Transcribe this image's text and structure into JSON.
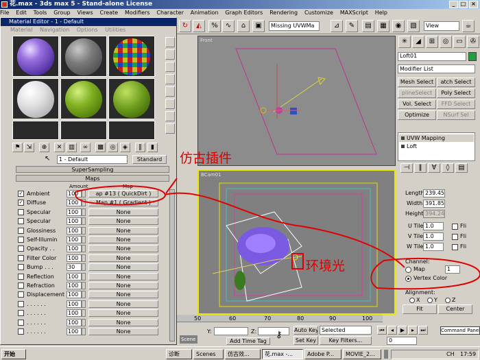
{
  "titlebar": {
    "title": "花.max - 3ds max 5 - Stand-alone License"
  },
  "menus": [
    "File",
    "Edit",
    "Tools",
    "Group",
    "Views",
    "Create",
    "Modifiers",
    "Character",
    "Animation",
    "Graph Editors",
    "Rendering",
    "Customize",
    "MAXScript",
    "Help"
  ],
  "toolbar": {
    "uvw_select": "Missing UVWMa",
    "view_select": "View"
  },
  "material_editor": {
    "title": "Material Editor - 1 - Default",
    "menu": [
      "Material",
      "Navigation",
      "Options",
      "Utilities"
    ],
    "material_name": "1 - Default",
    "material_type": "Standard",
    "rollouts": {
      "supersampling": "SuperSampling",
      "maps": "Maps"
    },
    "headers": {
      "amount": "Amount",
      "map": "Map"
    },
    "maps": [
      {
        "label": "Ambient",
        "checked": true,
        "amount": "100",
        "map": "ap #13  ( QuickDirt )"
      },
      {
        "label": "Diffuse",
        "checked": true,
        "amount": "100",
        "map": "Map #1  ( Gradient )"
      },
      {
        "label": "Specular",
        "checked": false,
        "amount": "100",
        "map": "None"
      },
      {
        "label": "Specular",
        "checked": false,
        "amount": "100",
        "map": "None"
      },
      {
        "label": "Glossiness",
        "checked": false,
        "amount": "100",
        "map": "None"
      },
      {
        "label": "Self-Illumin",
        "checked": false,
        "amount": "100",
        "map": "None"
      },
      {
        "label": "Opacity . .",
        "checked": false,
        "amount": "100",
        "map": "None"
      },
      {
        "label": "Filter Color",
        "checked": false,
        "amount": "100",
        "map": "None"
      },
      {
        "label": "Bump . . .",
        "checked": false,
        "amount": "30",
        "map": "None"
      },
      {
        "label": "Reflection",
        "checked": false,
        "amount": "100",
        "map": "None"
      },
      {
        "label": "Refraction",
        "checked": false,
        "amount": "100",
        "map": "None"
      },
      {
        "label": "Displacement",
        "checked": false,
        "amount": "100",
        "map": "None"
      },
      {
        "label": ". . . . . .",
        "checked": false,
        "amount": "100",
        "map": "None"
      },
      {
        "label": ". . . . . .",
        "checked": false,
        "amount": "100",
        "map": "None"
      },
      {
        "label": ". . . . . .",
        "checked": false,
        "amount": "100",
        "map": "None"
      },
      {
        "label": ". . . . . .",
        "checked": false,
        "amount": "100",
        "map": "None"
      }
    ]
  },
  "viewports": {
    "front": "Front",
    "camera": "BCam01"
  },
  "command_panel": {
    "object_name": "Loft01",
    "modifier_list": "Modifier List",
    "buttons": [
      "Mesh Select",
      "atch Select",
      "plineSelect",
      "Poly Select",
      "Vol. Select",
      "FFD Select",
      "Optimize",
      "NSurf Sel"
    ],
    "stack": [
      "UVW Mapping",
      "Loft"
    ],
    "length_label": "Length:",
    "length": "239.45",
    "width_label": "Width:",
    "width": "391.85",
    "height_label": "Height:",
    "height": "394.24",
    "utile_label": "U Tile:",
    "utile": "1.0",
    "vtile_label": "V Tile:",
    "vtile": "1.0",
    "wtile_label": "W Tile:",
    "wtile": "1.0",
    "flip": "Fli",
    "channel_label": "Channel:",
    "channel_map": "Map",
    "channel_value": "1",
    "vertex_color": "Vertex Color",
    "alignment_label": "Alignment:",
    "align_x": "X",
    "align_y": "Y",
    "align_z": "Z",
    "fit": "Fit",
    "center": "Center"
  },
  "timeline": {
    "ticks": [
      "50",
      "60",
      "70",
      "80",
      "90",
      "100"
    ]
  },
  "statusbar": {
    "y_label": "Y:",
    "z_label": "Z:",
    "add_time_tag": "Add Time Tag",
    "auto_key": "Auto Key",
    "selected": "Selected",
    "set_key": "Set Key",
    "key_filters": "Key Filters...",
    "frame": "0",
    "command_panel": "Command Panel",
    "scene_tab": "Scene"
  },
  "annotations": {
    "plugin": "仿古插件",
    "ambient": "环境光"
  },
  "taskbar": {
    "start": "开始",
    "tasks": [
      "诊断",
      "Scenes",
      "仿古效...",
      "花.max -...",
      "Adobe P...",
      "MOVIE_2..."
    ],
    "lang": "CH",
    "clock": "17:59"
  },
  "colors": {
    "annotation": "#e00000",
    "viewport_active": "#e8e800",
    "title": "#0a246a"
  }
}
